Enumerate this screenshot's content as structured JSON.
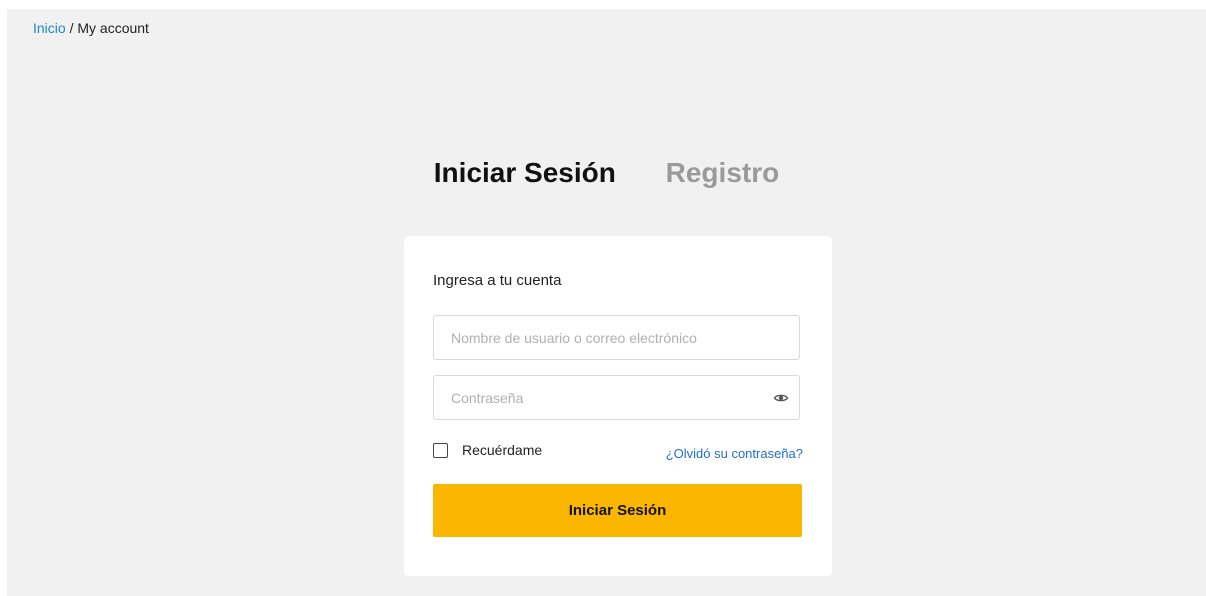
{
  "breadcrumb": {
    "home": "Inicio",
    "separator": " / ",
    "current": "My account"
  },
  "tabs": {
    "login": "Iniciar Sesión",
    "register": "Registro"
  },
  "login_form": {
    "title": "Ingresa a tu cuenta",
    "username_placeholder": "Nombre de usuario o correo electrónico",
    "password_placeholder": "Contraseña",
    "password_toggle_icon": "eye-icon",
    "remember_label": "Recuérdame",
    "remember_checked": false,
    "forgot_link": "¿Olvidó su contraseña?",
    "submit_label": "Iniciar Sesión"
  },
  "colors": {
    "page_background": "#f1f1f1",
    "link_blue": "#1e88c7",
    "forgot_link_blue": "#1e6fd0",
    "button_yellow": "#fbb600",
    "inactive_tab_gray": "#9a9a9a"
  }
}
